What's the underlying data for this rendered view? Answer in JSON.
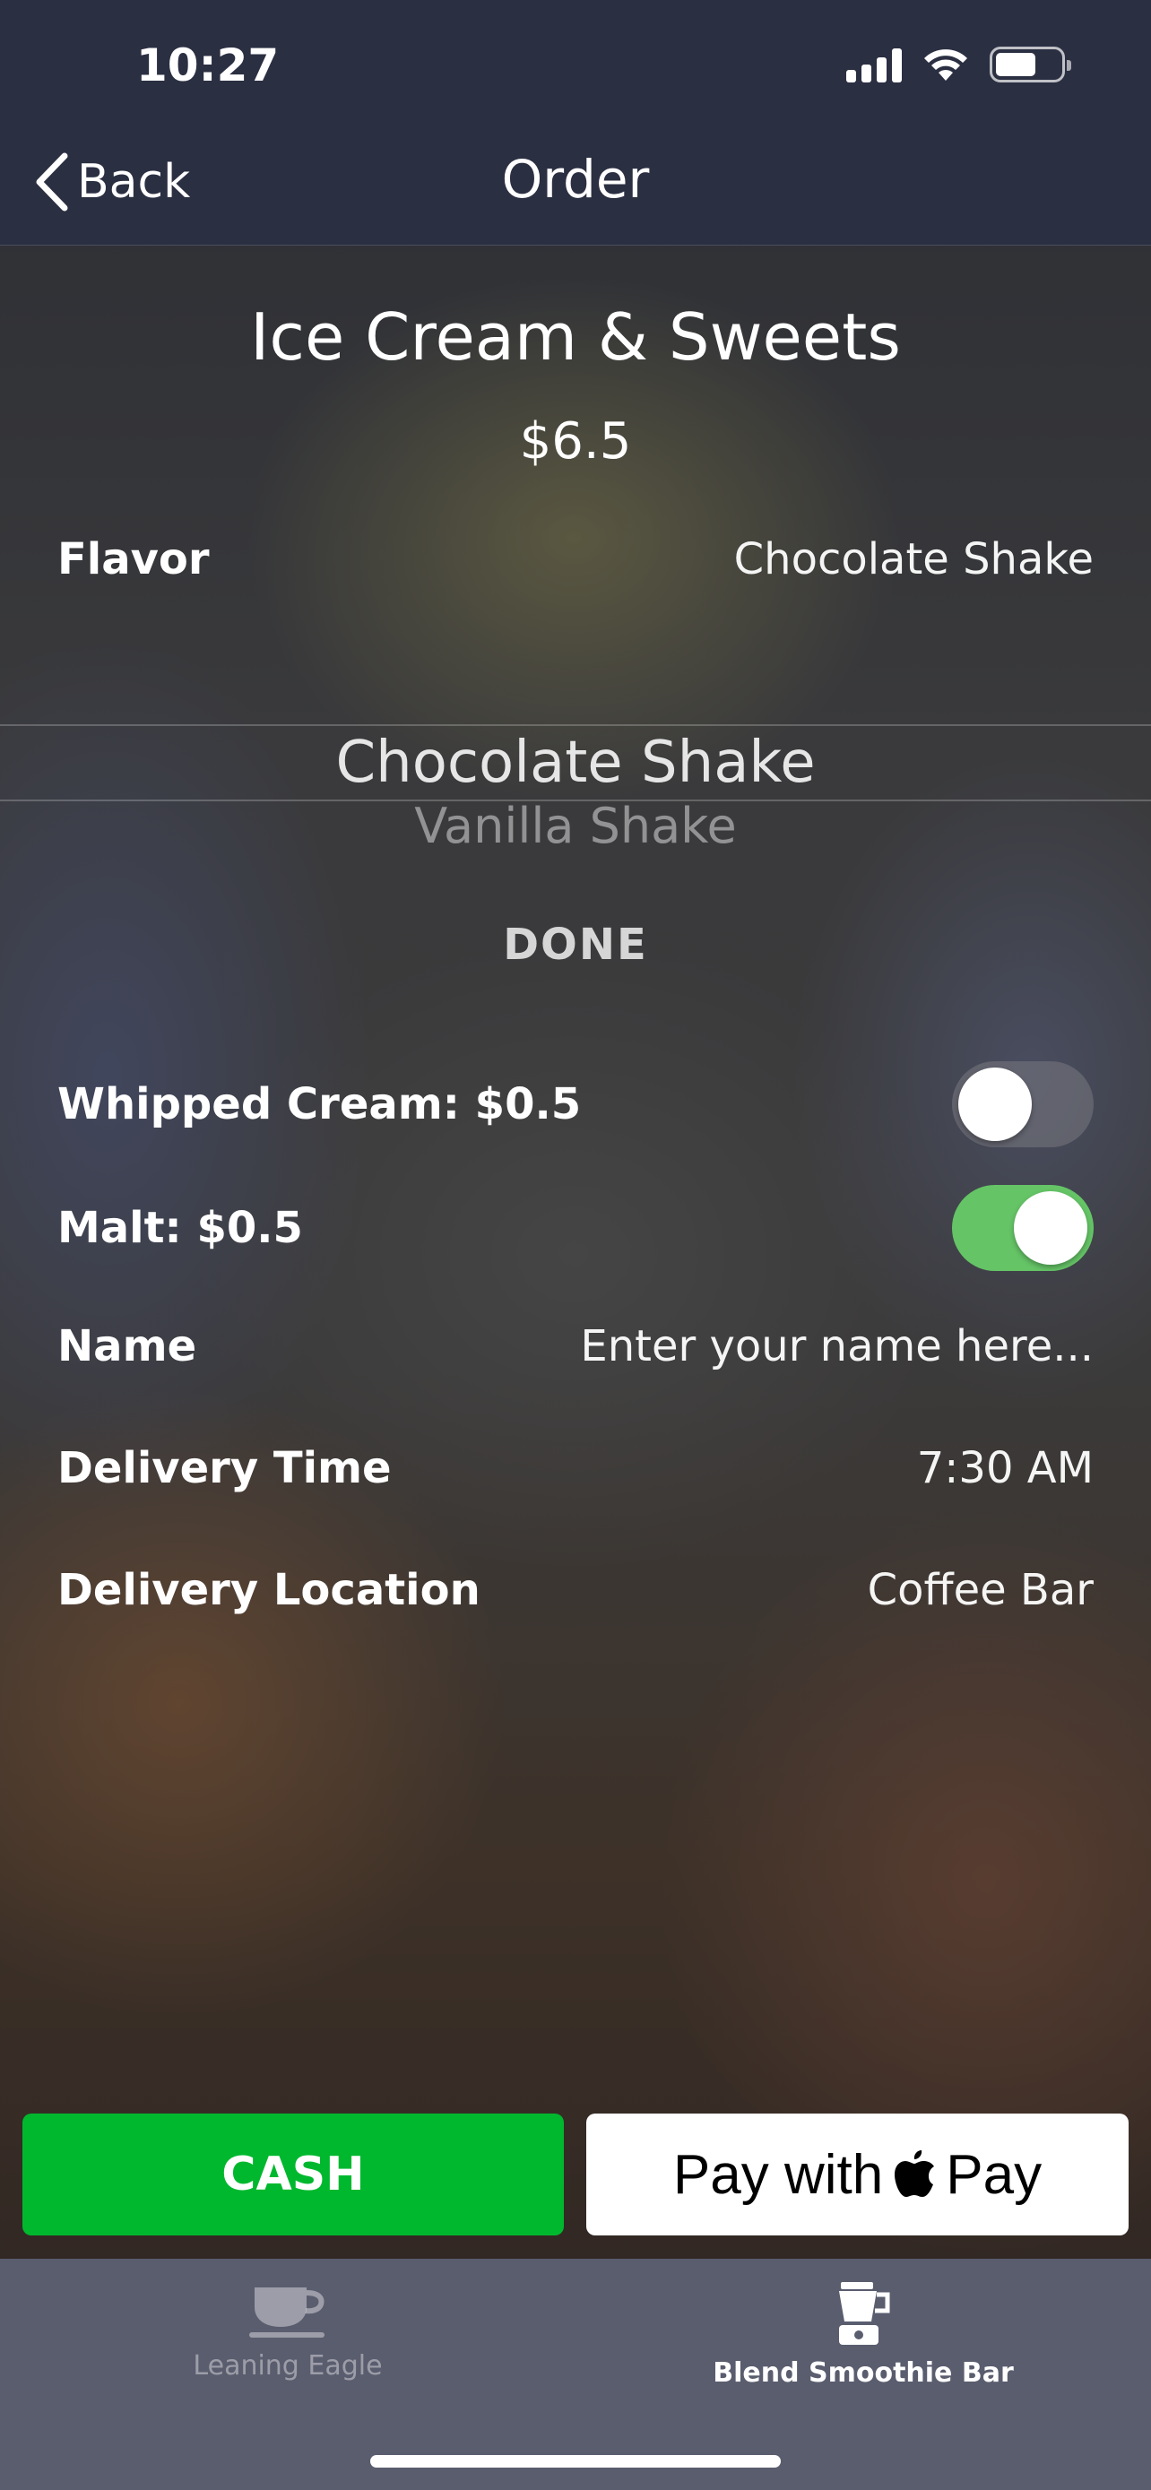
{
  "status_bar": {
    "time": "10:27"
  },
  "nav": {
    "back_label": "Back",
    "title": "Order"
  },
  "item": {
    "title": "Ice Cream & Sweets",
    "price": "$6.5"
  },
  "flavor": {
    "label": "Flavor",
    "value": "Chocolate Shake",
    "picker": {
      "selected": "Chocolate Shake",
      "next": "Vanilla Shake",
      "done_label": "DONE"
    }
  },
  "options": [
    {
      "label": "Whipped Cream: $0.5",
      "on": false
    },
    {
      "label": "Malt: $0.5",
      "on": true
    }
  ],
  "fields": {
    "name": {
      "label": "Name",
      "placeholder": "Enter your name here..."
    },
    "delivery_time": {
      "label": "Delivery Time",
      "value": "7:30 AM"
    },
    "delivery_location": {
      "label": "Delivery Location",
      "value": "Coffee Bar"
    }
  },
  "payment": {
    "cash_label": "CASH",
    "apple_pay_label_prefix": "Pay with",
    "apple_pay_label_suffix": "Pay"
  },
  "tabs": [
    {
      "label": "Leaning Eagle",
      "icon": "coffee-cup-icon",
      "active": false
    },
    {
      "label": "Blend Smoothie Bar",
      "icon": "blender-icon",
      "active": true
    }
  ],
  "colors": {
    "cash_green": "#00b82e",
    "toggle_on": "#65c466",
    "nav_bg": "#2b2f42",
    "tabbar_bg": "#5a5d6e"
  }
}
